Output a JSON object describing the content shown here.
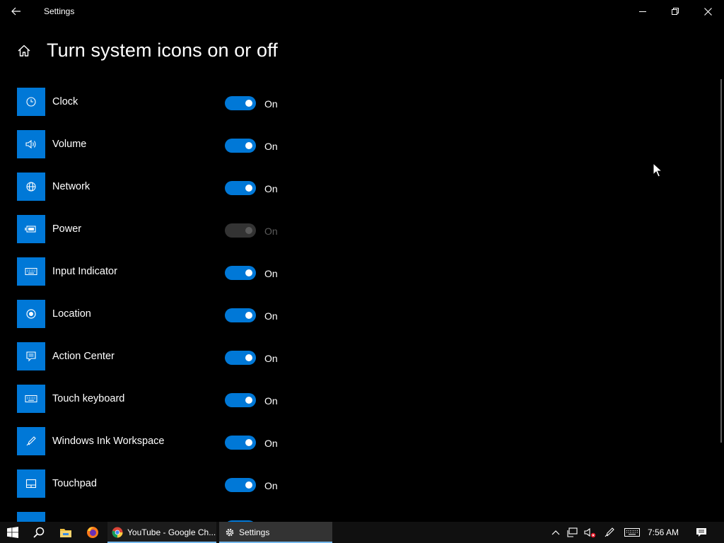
{
  "window": {
    "title": "Settings",
    "icons": {
      "back": "back-arrow-icon",
      "minimize": "minimize-icon",
      "maximize": "restore-icon",
      "close": "close-icon"
    }
  },
  "header": {
    "title": "Turn system icons on or off",
    "home_icon": "home-icon"
  },
  "items": [
    {
      "label": "Clock",
      "icon": "clock-icon",
      "state": "On",
      "enabled": true
    },
    {
      "label": "Volume",
      "icon": "volume-icon",
      "state": "On",
      "enabled": true
    },
    {
      "label": "Network",
      "icon": "network-icon",
      "state": "On",
      "enabled": true
    },
    {
      "label": "Power",
      "icon": "battery-icon",
      "state": "On",
      "enabled": false
    },
    {
      "label": "Input Indicator",
      "icon": "keyboard-icon",
      "state": "On",
      "enabled": true
    },
    {
      "label": "Location",
      "icon": "location-icon",
      "state": "On",
      "enabled": true
    },
    {
      "label": "Action Center",
      "icon": "action-center-icon",
      "state": "On",
      "enabled": true
    },
    {
      "label": "Touch keyboard",
      "icon": "touch-keyboard-icon",
      "state": "On",
      "enabled": true
    },
    {
      "label": "Windows Ink Workspace",
      "icon": "pen-icon",
      "state": "On",
      "enabled": true
    },
    {
      "label": "Touchpad",
      "icon": "touchpad-icon",
      "state": "On",
      "enabled": true
    }
  ],
  "colors": {
    "accent": "#0078d7",
    "background": "#000000",
    "disabled": "#5a5a5a",
    "taskbar": "#101010"
  },
  "taskbar": {
    "chrome_label": "YouTube - Google Ch...",
    "settings_label": "Settings",
    "time": "7:56 AM"
  }
}
